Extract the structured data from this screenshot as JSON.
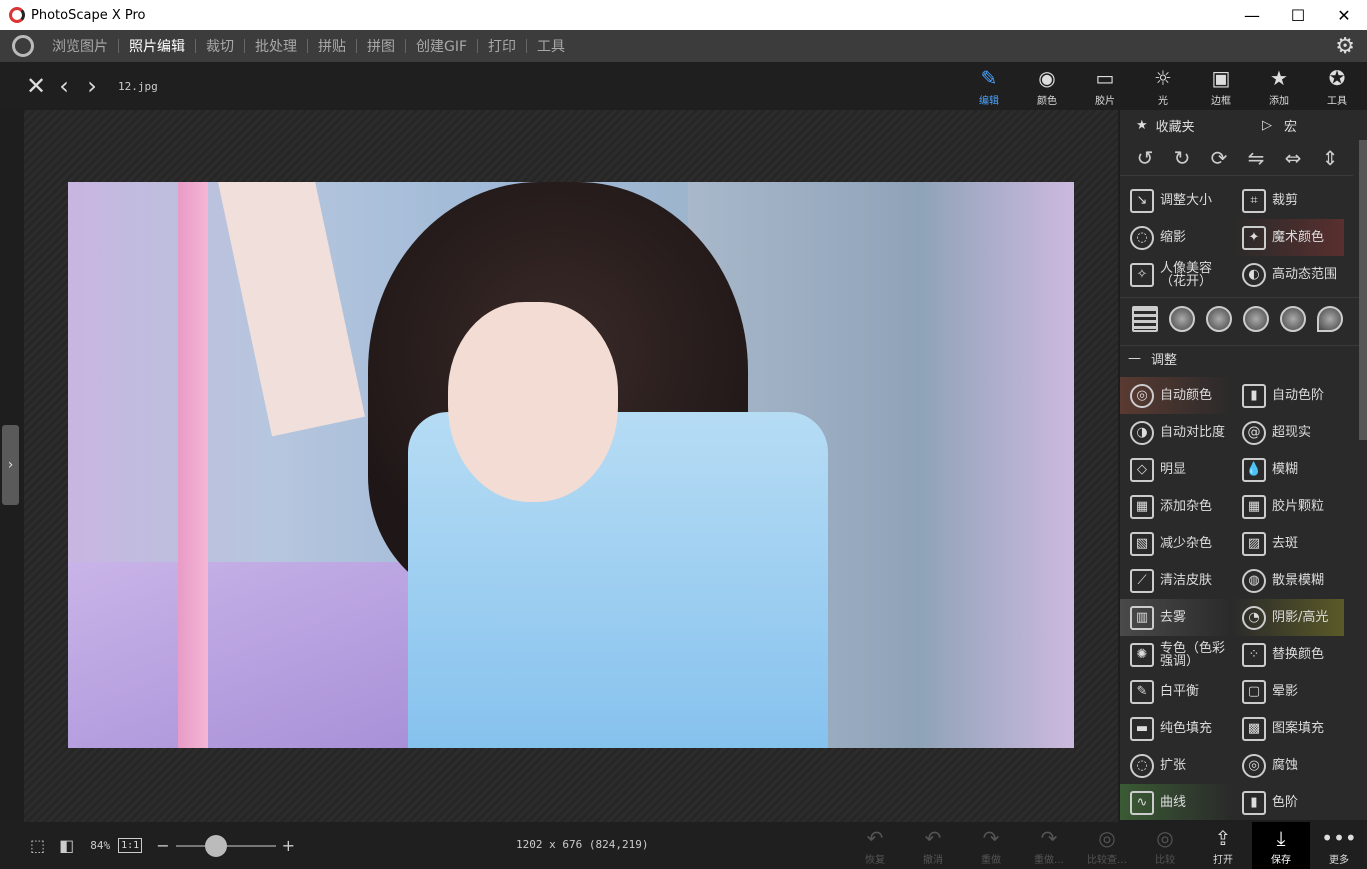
{
  "window": {
    "title": "PhotoScape X Pro",
    "min": "—",
    "max": "☐",
    "close": "✕"
  },
  "menu": {
    "items": [
      "浏览图片",
      "照片编辑",
      "裁切",
      "批处理",
      "拼贴",
      "拼图",
      "创建GIF",
      "打印",
      "工具"
    ],
    "active": 1
  },
  "file": {
    "name": "12.jpg"
  },
  "tools": [
    {
      "label": "编辑",
      "icon": "pencil-icon",
      "glyph": "✎"
    },
    {
      "label": "颜色",
      "icon": "color-icon",
      "glyph": "◉"
    },
    {
      "label": "胶片",
      "icon": "film-icon",
      "glyph": "▭"
    },
    {
      "label": "光",
      "icon": "sun-icon",
      "glyph": "☼"
    },
    {
      "label": "边框",
      "icon": "frame-icon",
      "glyph": "▣"
    },
    {
      "label": "添加",
      "icon": "add-icon",
      "glyph": "★"
    },
    {
      "label": "工具",
      "icon": "palette-icon",
      "glyph": "✪"
    }
  ],
  "panel": {
    "favorites": "收藏夹",
    "macro": "宏",
    "rotate_icons": [
      "↺",
      "↻",
      "⟳",
      "⇋",
      "⇔",
      "⇕"
    ],
    "top_items": [
      {
        "label": "调整大小",
        "icon": "resize-icon",
        "glyph": "↘"
      },
      {
        "label": "裁剪",
        "icon": "crop-icon",
        "glyph": "⌗"
      },
      {
        "label": "缩影",
        "icon": "vignette-icon",
        "glyph": "◌",
        "round": true
      },
      {
        "label": "魔术颜色",
        "icon": "magic-wand-icon",
        "glyph": "✦",
        "hl": "red"
      },
      {
        "label": "人像美容（花开）",
        "icon": "beauty-icon",
        "glyph": "✧"
      },
      {
        "label": "高动态范围",
        "icon": "hdr-icon",
        "glyph": "◐",
        "round": true
      }
    ],
    "adjust_title": "调整",
    "adjust_items": [
      {
        "label": "自动颜色",
        "icon": "auto-color-icon",
        "glyph": "◎",
        "round": true,
        "hl": "warm"
      },
      {
        "label": "自动色阶",
        "icon": "auto-levels-icon",
        "glyph": "▮"
      },
      {
        "label": "自动对比度",
        "icon": "auto-contrast-icon",
        "glyph": "◑",
        "round": true
      },
      {
        "label": "超现实",
        "icon": "surreal-icon",
        "glyph": "@",
        "round": true
      },
      {
        "label": "明显",
        "icon": "clarity-icon",
        "glyph": "◇"
      },
      {
        "label": "模糊",
        "icon": "blur-icon",
        "glyph": "💧"
      },
      {
        "label": "添加杂色",
        "icon": "add-noise-icon",
        "glyph": "▦"
      },
      {
        "label": "胶片颗粒",
        "icon": "film-grain-icon",
        "glyph": "▦"
      },
      {
        "label": "减少杂色",
        "icon": "denoise-icon",
        "glyph": "▧"
      },
      {
        "label": "去斑",
        "icon": "despeckle-icon",
        "glyph": "▨"
      },
      {
        "label": "清洁皮肤",
        "icon": "clean-skin-icon",
        "glyph": "⟋"
      },
      {
        "label": "散景模糊",
        "icon": "bokeh-icon",
        "glyph": "◍",
        "round": true
      },
      {
        "label": "去雾",
        "icon": "dehaze-icon",
        "glyph": "▥",
        "hl": "gray"
      },
      {
        "label": "阴影/高光",
        "icon": "shadow-highlight-icon",
        "glyph": "◔",
        "round": true,
        "hl": "olive"
      },
      {
        "label": "专色（色彩强调）",
        "icon": "color-splash-icon",
        "glyph": "✺"
      },
      {
        "label": "替换颜色",
        "icon": "replace-color-icon",
        "glyph": "⁘"
      },
      {
        "label": "白平衡",
        "icon": "white-balance-icon",
        "glyph": "✎"
      },
      {
        "label": "晕影",
        "icon": "vignette2-icon",
        "glyph": "▢"
      },
      {
        "label": "纯色填充",
        "icon": "color-fill-icon",
        "glyph": "▬"
      },
      {
        "label": "图案填充",
        "icon": "pattern-fill-icon",
        "glyph": "▩"
      },
      {
        "label": "扩张",
        "icon": "dilate-icon",
        "glyph": "◌",
        "round": true
      },
      {
        "label": "腐蚀",
        "icon": "erode-icon",
        "glyph": "◎",
        "round": true
      },
      {
        "label": "曲线",
        "icon": "curves-icon",
        "glyph": "∿",
        "hl": "green"
      },
      {
        "label": "色阶",
        "icon": "levels-icon",
        "glyph": "▮"
      }
    ]
  },
  "bottom": {
    "zoom": "84%",
    "one_to_one": "1:1",
    "zoom_level": 0.4,
    "dims": "1202 x 676 (824,219)",
    "actions": [
      {
        "label": "恢复",
        "glyph": "↶",
        "enabled": false
      },
      {
        "label": "撤消",
        "glyph": "↶",
        "enabled": false
      },
      {
        "label": "重做",
        "glyph": "↷",
        "enabled": false
      },
      {
        "label": "重做…",
        "glyph": "↷",
        "enabled": false
      },
      {
        "label": "比较查…",
        "glyph": "◎",
        "enabled": false
      },
      {
        "label": "比较",
        "glyph": "◎",
        "enabled": false
      },
      {
        "label": "打开",
        "glyph": "⇪",
        "enabled": true
      },
      {
        "label": "保存",
        "glyph": "⤓",
        "enabled": true,
        "save": true
      },
      {
        "label": "更多",
        "glyph": "•••",
        "enabled": true
      }
    ]
  }
}
